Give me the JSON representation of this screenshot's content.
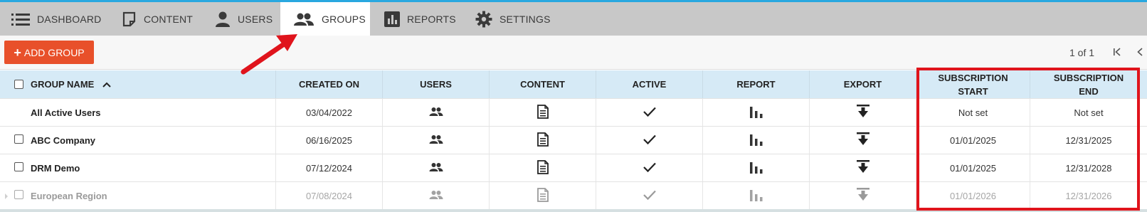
{
  "nav": {
    "items": [
      {
        "label": "DASHBOARD",
        "icon": "list-icon"
      },
      {
        "label": "CONTENT",
        "icon": "document-icon"
      },
      {
        "label": "USERS",
        "icon": "user-icon"
      },
      {
        "label": "GROUPS",
        "icon": "group-icon",
        "active": true
      },
      {
        "label": "REPORTS",
        "icon": "bar-chart-icon"
      },
      {
        "label": "SETTINGS",
        "icon": "gear-icon"
      }
    ]
  },
  "toolbar": {
    "add_label": "ADD GROUP",
    "pager": "1 of 1"
  },
  "table": {
    "columns": {
      "name": "GROUP NAME",
      "created": "CREATED ON",
      "users": "USERS",
      "content": "CONTENT",
      "active": "ACTIVE",
      "report": "REPORT",
      "export": "EXPORT",
      "sub_start_1": "SUBSCRIPTION",
      "sub_start_2": "START",
      "sub_end_1": "SUBSCRIPTION",
      "sub_end_2": "END"
    },
    "rows": [
      {
        "name": "All Active Users",
        "created": "03/04/2022",
        "sub_start": "Not set",
        "sub_end": "Not set"
      },
      {
        "name": "ABC Company",
        "created": "06/16/2025",
        "sub_start": "01/01/2025",
        "sub_end": "12/31/2025"
      },
      {
        "name": "DRM Demo",
        "created": "07/12/2024",
        "sub_start": "01/01/2025",
        "sub_end": "12/31/2028"
      },
      {
        "name": "European Region",
        "created": "07/08/2024",
        "sub_start": "01/01/2026",
        "sub_end": "12/31/2026"
      }
    ]
  },
  "colors": {
    "accent_button": "#e8502a",
    "header_bg": "#d6eaf6",
    "nav_bg": "#c8c8c8",
    "annotation": "#e0141c"
  }
}
